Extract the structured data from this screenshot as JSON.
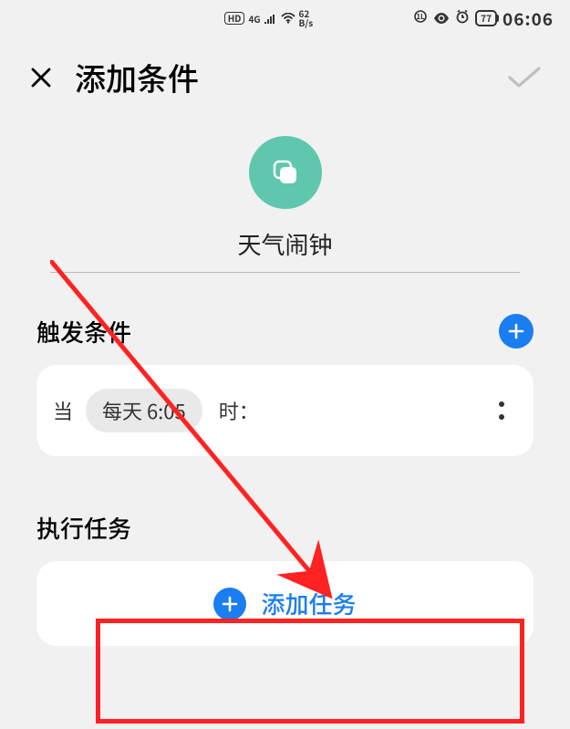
{
  "status": {
    "hd": "HD",
    "net_4g": "4G",
    "speed_top": "62",
    "speed_bot": "B/s",
    "battery": "77",
    "time": "06:06"
  },
  "header": {
    "title": "添加条件"
  },
  "task_name": "天气闹钟",
  "trigger": {
    "title": "触发条件",
    "when_label": "当",
    "chip_value": "每天 6:05",
    "after_label": "时："
  },
  "exec": {
    "title": "执行任务",
    "add_label": "添加任务"
  }
}
